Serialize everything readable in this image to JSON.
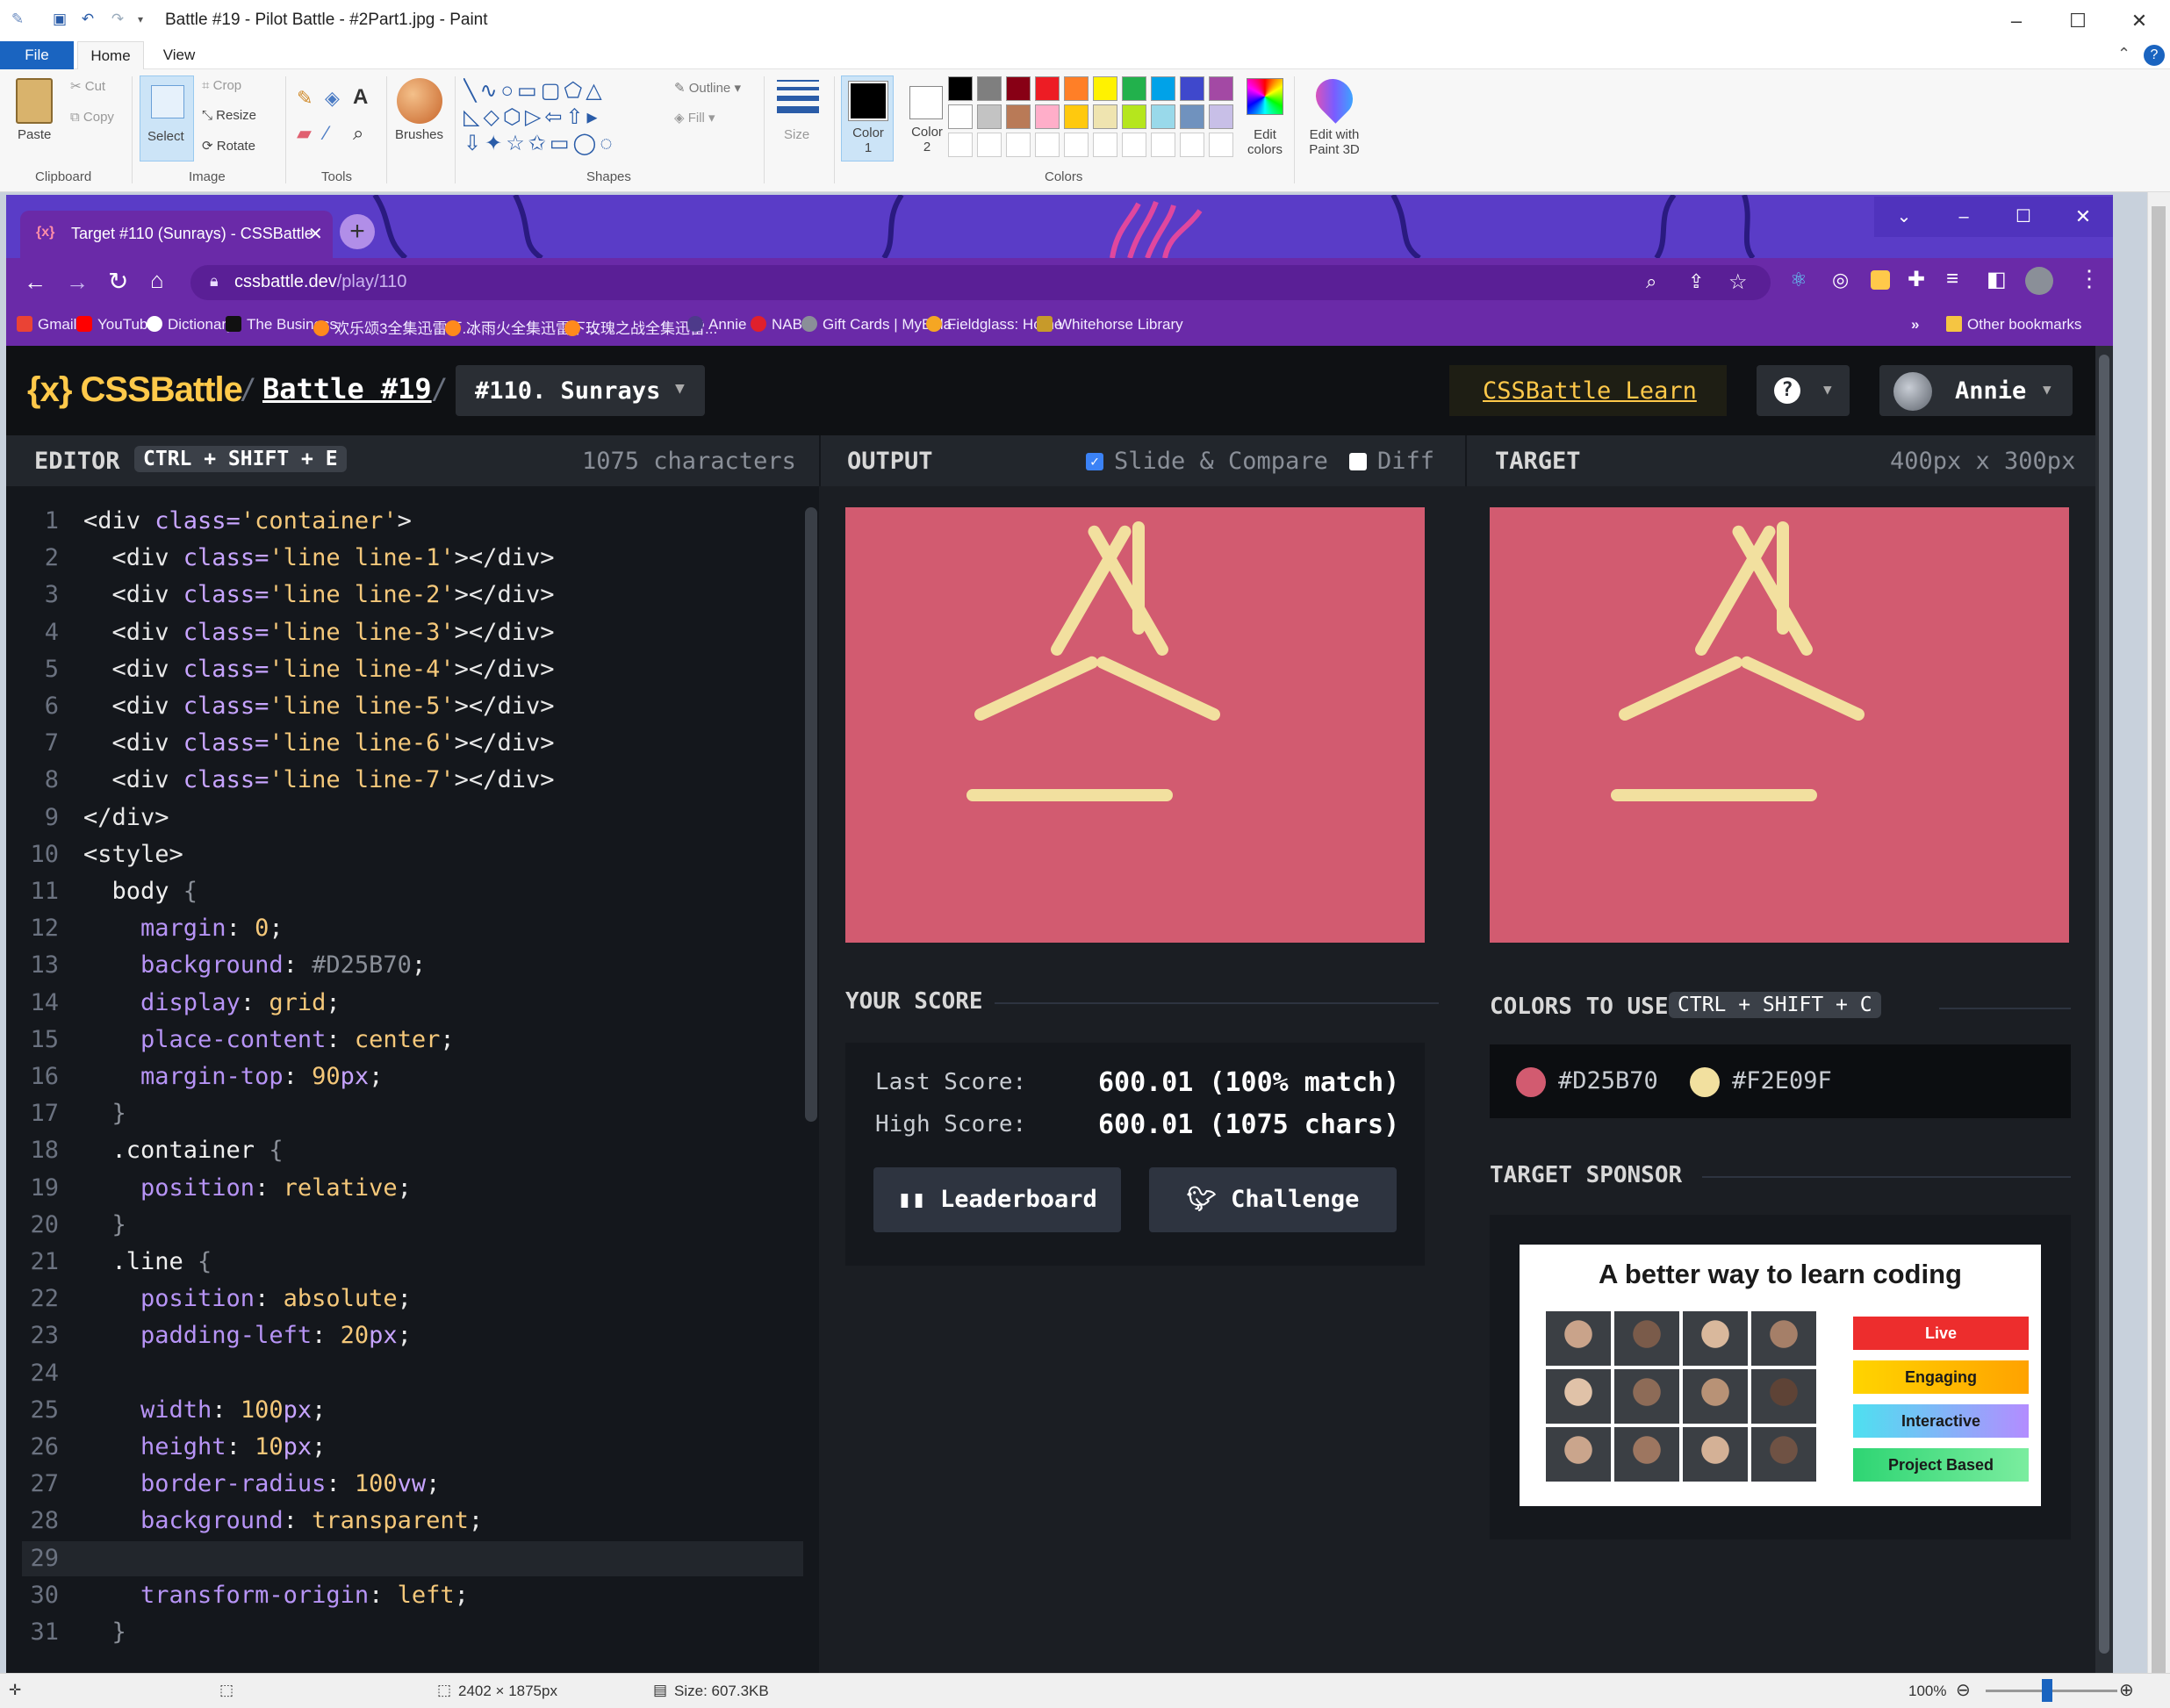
{
  "paint": {
    "window_title": "Battle #19 - Pilot Battle - #2Part1.jpg - Paint",
    "menu": {
      "file": "File",
      "home": "Home",
      "view": "View"
    },
    "clipboard": {
      "paste": "Paste",
      "cut": "Cut",
      "copy": "Copy",
      "group": "Clipboard"
    },
    "image": {
      "select": "Select",
      "crop": "Crop",
      "resize": "Resize",
      "rotate": "Rotate",
      "group": "Image"
    },
    "tools": {
      "group": "Tools"
    },
    "brushes": "Brushes",
    "shapes": {
      "outline": "Outline",
      "fill": "Fill",
      "group": "Shapes"
    },
    "size": "Size",
    "color1": {
      "line1": "Color",
      "line2": "1"
    },
    "color2": {
      "line1": "Color",
      "line2": "2"
    },
    "colors_group": "Colors",
    "edit_colors": {
      "line1": "Edit",
      "line2": "colors"
    },
    "edit_paint3d": {
      "line1": "Edit with",
      "line2": "Paint 3D"
    },
    "palette_row1": [
      "#000000",
      "#7f7f7f",
      "#880015",
      "#ed1c24",
      "#ff7f27",
      "#fff200",
      "#22b14c",
      "#00a2e8",
      "#3f48cc",
      "#a349a4"
    ],
    "palette_row2": [
      "#ffffff",
      "#c3c3c3",
      "#b97a57",
      "#ffaec9",
      "#ffc90e",
      "#efe4b0",
      "#b5e61d",
      "#99d9ea",
      "#7092be",
      "#c8bfe7"
    ],
    "status": {
      "dimensions": "2402 × 1875px",
      "size": "Size: 607.3KB",
      "zoom": "100%"
    }
  },
  "browser": {
    "tab_title": "Target #110 (Sunrays) - CSSBattle",
    "url_host": "cssbattle.dev",
    "url_path": "/play/110",
    "bookmarks": [
      "Gmail",
      "YouTube",
      "Dictionary",
      "The Business",
      "欢乐颂3全集迅雷下...",
      "冰雨火全集迅雷下...",
      "玫瑰之战全集迅雷...",
      "Annie",
      "NAB",
      "Gift Cards | MyBala...",
      "Fieldglass: Home",
      "Whitehorse Library"
    ],
    "bookmarks_more": "»",
    "other_bookmarks": "Other bookmarks"
  },
  "app": {
    "logo": "CSSBattle",
    "logo_icon": "{x}",
    "breadcrumb_sep": "/",
    "battle": "Battle #19",
    "target_select": "#110. Sunrays",
    "learn": "CSSBattle Learn",
    "help": "?",
    "user": "Annie",
    "editor": {
      "title": "EDITOR",
      "shortcut": "CTRL + SHIFT + E",
      "chars": "1075 characters"
    },
    "output": {
      "title": "OUTPUT",
      "slide_compare": "Slide & Compare",
      "diff": "Diff"
    },
    "target": {
      "title": "TARGET",
      "size": "400px x 300px"
    },
    "score": {
      "title": "YOUR SCORE",
      "last_label": "Last Score:",
      "last_value": "600.01 (100% match)",
      "high_label": "High Score:",
      "high_value": "600.01 (1075 chars)",
      "leaderboard": "Leaderboard",
      "challenge": "Challenge"
    },
    "colors": {
      "title": "COLORS TO USE",
      "shortcut": "CTRL + SHIFT + C",
      "list": [
        "#D25B70",
        "#F2E09F"
      ]
    },
    "sponsor": {
      "title": "TARGET SPONSOR",
      "headline": "A better way to learn coding",
      "tags": [
        "Live",
        "Engaging",
        "Interactive",
        "Project Based"
      ]
    },
    "code_lines": [
      [
        {
          "t": "<div ",
          "c": "t"
        },
        {
          "t": "class=",
          "c": "a"
        },
        {
          "t": "'container'",
          "c": "s"
        },
        {
          "t": ">",
          "c": "t"
        }
      ],
      [
        {
          "t": "  <div ",
          "c": "t"
        },
        {
          "t": "class=",
          "c": "a"
        },
        {
          "t": "'line line-1'",
          "c": "s"
        },
        {
          "t": "></div>",
          "c": "t"
        }
      ],
      [
        {
          "t": "  <div ",
          "c": "t"
        },
        {
          "t": "class=",
          "c": "a"
        },
        {
          "t": "'line line-2'",
          "c": "s"
        },
        {
          "t": "></div>",
          "c": "t"
        }
      ],
      [
        {
          "t": "  <div ",
          "c": "t"
        },
        {
          "t": "class=",
          "c": "a"
        },
        {
          "t": "'line line-3'",
          "c": "s"
        },
        {
          "t": "></div>",
          "c": "t"
        }
      ],
      [
        {
          "t": "  <div ",
          "c": "t"
        },
        {
          "t": "class=",
          "c": "a"
        },
        {
          "t": "'line line-4'",
          "c": "s"
        },
        {
          "t": "></div>",
          "c": "t"
        }
      ],
      [
        {
          "t": "  <div ",
          "c": "t"
        },
        {
          "t": "class=",
          "c": "a"
        },
        {
          "t": "'line line-5'",
          "c": "s"
        },
        {
          "t": "></div>",
          "c": "t"
        }
      ],
      [
        {
          "t": "  <div ",
          "c": "t"
        },
        {
          "t": "class=",
          "c": "a"
        },
        {
          "t": "'line line-6'",
          "c": "s"
        },
        {
          "t": "></div>",
          "c": "t"
        }
      ],
      [
        {
          "t": "  <div ",
          "c": "t"
        },
        {
          "t": "class=",
          "c": "a"
        },
        {
          "t": "'line line-7'",
          "c": "s"
        },
        {
          "t": "></div>",
          "c": "t"
        }
      ],
      [
        {
          "t": "</div>",
          "c": "t"
        }
      ],
      [
        {
          "t": "<style>",
          "c": "t"
        }
      ],
      [
        {
          "t": "  body ",
          "c": "sel"
        },
        {
          "t": "{",
          "c": "pu"
        }
      ],
      [
        {
          "t": "    margin",
          "c": "p"
        },
        {
          "t": ": ",
          "c": "t"
        },
        {
          "t": "0",
          "c": "v"
        },
        {
          "t": ";",
          "c": "t"
        }
      ],
      [
        {
          "t": "    background",
          "c": "p"
        },
        {
          "t": ": ",
          "c": "t"
        },
        {
          "t": "#D25B70",
          "c": "pu"
        },
        {
          "t": ";",
          "c": "t"
        }
      ],
      [
        {
          "t": "    display",
          "c": "p"
        },
        {
          "t": ": ",
          "c": "t"
        },
        {
          "t": "grid",
          "c": "v"
        },
        {
          "t": ";",
          "c": "t"
        }
      ],
      [
        {
          "t": "    place-content",
          "c": "p"
        },
        {
          "t": ": ",
          "c": "t"
        },
        {
          "t": "center",
          "c": "v"
        },
        {
          "t": ";",
          "c": "t"
        }
      ],
      [
        {
          "t": "    margin-top",
          "c": "p"
        },
        {
          "t": ": ",
          "c": "t"
        },
        {
          "t": "90",
          "c": "v"
        },
        {
          "t": "px",
          "c": "a"
        },
        {
          "t": ";",
          "c": "t"
        }
      ],
      [
        {
          "t": "  }",
          "c": "pu"
        }
      ],
      [
        {
          "t": "  .container ",
          "c": "sel"
        },
        {
          "t": "{",
          "c": "pu"
        }
      ],
      [
        {
          "t": "    position",
          "c": "p"
        },
        {
          "t": ": ",
          "c": "t"
        },
        {
          "t": "relative",
          "c": "v"
        },
        {
          "t": ";",
          "c": "t"
        }
      ],
      [
        {
          "t": "  }",
          "c": "pu"
        }
      ],
      [
        {
          "t": "  .line ",
          "c": "sel"
        },
        {
          "t": "{",
          "c": "pu"
        }
      ],
      [
        {
          "t": "    position",
          "c": "p"
        },
        {
          "t": ": ",
          "c": "t"
        },
        {
          "t": "absolute",
          "c": "v"
        },
        {
          "t": ";",
          "c": "t"
        }
      ],
      [
        {
          "t": "    padding-left",
          "c": "p"
        },
        {
          "t": ": ",
          "c": "t"
        },
        {
          "t": "20",
          "c": "v"
        },
        {
          "t": "px",
          "c": "a"
        },
        {
          "t": ";",
          "c": "t"
        }
      ],
      [],
      [
        {
          "t": "    width",
          "c": "p"
        },
        {
          "t": ": ",
          "c": "t"
        },
        {
          "t": "100",
          "c": "v"
        },
        {
          "t": "px",
          "c": "a"
        },
        {
          "t": ";",
          "c": "t"
        }
      ],
      [
        {
          "t": "    height",
          "c": "p"
        },
        {
          "t": ": ",
          "c": "t"
        },
        {
          "t": "10",
          "c": "v"
        },
        {
          "t": "px",
          "c": "a"
        },
        {
          "t": ";",
          "c": "t"
        }
      ],
      [
        {
          "t": "    border-radius",
          "c": "p"
        },
        {
          "t": ": ",
          "c": "t"
        },
        {
          "t": "100",
          "c": "v"
        },
        {
          "t": "vw",
          "c": "a"
        },
        {
          "t": ";",
          "c": "t"
        }
      ],
      [
        {
          "t": "    background",
          "c": "p"
        },
        {
          "t": ": ",
          "c": "t"
        },
        {
          "t": "transparent",
          "c": "v"
        },
        {
          "t": ";",
          "c": "t"
        }
      ],
      [],
      [
        {
          "t": "    transform-origin",
          "c": "p"
        },
        {
          "t": ": ",
          "c": "t"
        },
        {
          "t": "left",
          "c": "v"
        },
        {
          "t": ";",
          "c": "t"
        }
      ],
      [
        {
          "t": "  }",
          "c": "pu"
        }
      ]
    ]
  }
}
